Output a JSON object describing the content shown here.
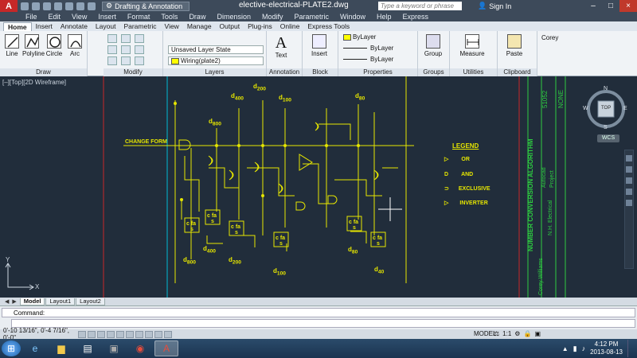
{
  "titlebar": {
    "app_logo": "A",
    "workspace": "Drafting & Annotation",
    "title": "elective-electrical-PLATE2.dwg",
    "search_placeholder": "Type a keyword or phrase",
    "signin": "Sign In",
    "controls": [
      "–",
      "□",
      "×"
    ]
  },
  "menu": [
    "File",
    "Edit",
    "View",
    "Insert",
    "Format",
    "Tools",
    "Draw",
    "Dimension",
    "Modify",
    "Parametric",
    "Window",
    "Help",
    "Express"
  ],
  "ribbon_tabs": [
    "Home",
    "Insert",
    "Annotate",
    "Layout",
    "Parametric",
    "View",
    "Manage",
    "Output",
    "Plug-ins",
    "Online",
    "Express Tools"
  ],
  "ribbon": {
    "draw": {
      "title": "Draw",
      "tools": [
        "Line",
        "Polyline",
        "Circle",
        "Arc"
      ]
    },
    "modify": {
      "title": "Modify"
    },
    "layers": {
      "title": "Layers",
      "state": "Unsaved Layer State",
      "current": "Wiring(plate2)"
    },
    "annotation": {
      "title": "Annotation",
      "tool": "Text"
    },
    "block": {
      "title": "Block",
      "tool": "Insert"
    },
    "properties": {
      "title": "Properties",
      "color": "ByLayer",
      "linetype": "ByLayer",
      "lineweight": "ByLayer"
    },
    "groups": {
      "title": "Groups",
      "tool": "Group"
    },
    "utilities": {
      "title": "Utilities",
      "tool": "Measure"
    },
    "clipboard": {
      "title": "Clipboard",
      "tool": "Paste"
    },
    "user": "Corey"
  },
  "viewport_label": "[–][Top][2D Wireframe]",
  "viewcube": {
    "top": "TOP",
    "n": "N",
    "s": "S",
    "e": "E",
    "w": "W",
    "wcs": "WCS"
  },
  "drawing": {
    "legend_title": "LEGEND",
    "legend": [
      {
        "symbol": "▷",
        "label": "OR"
      },
      {
        "symbol": "D",
        "label": "AND"
      },
      {
        "symbol": "⊃",
        "label": "EXCLUSIVE"
      },
      {
        "symbol": "▷",
        "label": "INVERTER"
      }
    ],
    "change_form": "CHANGE FORM",
    "inputs": [
      {
        "label": "d",
        "sub": "800"
      },
      {
        "label": "d",
        "sub": "400"
      },
      {
        "label": "d",
        "sub": "200"
      },
      {
        "label": "d",
        "sub": "100"
      },
      {
        "label": "d",
        "sub": "80"
      }
    ],
    "outputs": [
      {
        "label": "d",
        "sub": "800"
      },
      {
        "label": "d",
        "sub": "400"
      },
      {
        "label": "d",
        "sub": "200"
      },
      {
        "label": "d",
        "sub": "100"
      },
      {
        "label": "d",
        "sub": "80"
      },
      {
        "label": "d",
        "sub": "40"
      }
    ],
    "title_block": {
      "main": "NUMBER CONVERSION ALGORITHM",
      "sub1": "Autocad",
      "sub2": "Project",
      "none": "NONE",
      "num": "51052",
      "name": "Corey Williams",
      "school": "N.H. Electrical"
    }
  },
  "layout_tabs": [
    "Model",
    "Layout1",
    "Layout2"
  ],
  "command": {
    "label": "Command:",
    "prompt": ""
  },
  "status": {
    "coords": "0'-10 13/16\", 0'-4 7/16\", 0'-0\"",
    "model": "MODEL",
    "scale": "1:1"
  },
  "taskbar": {
    "time": "4:12 PM",
    "date": "2013-08-13"
  },
  "colors": {
    "drawing_bg": "#212d3b",
    "lines": "#e6e600",
    "accent_green": "#2ecc40"
  }
}
